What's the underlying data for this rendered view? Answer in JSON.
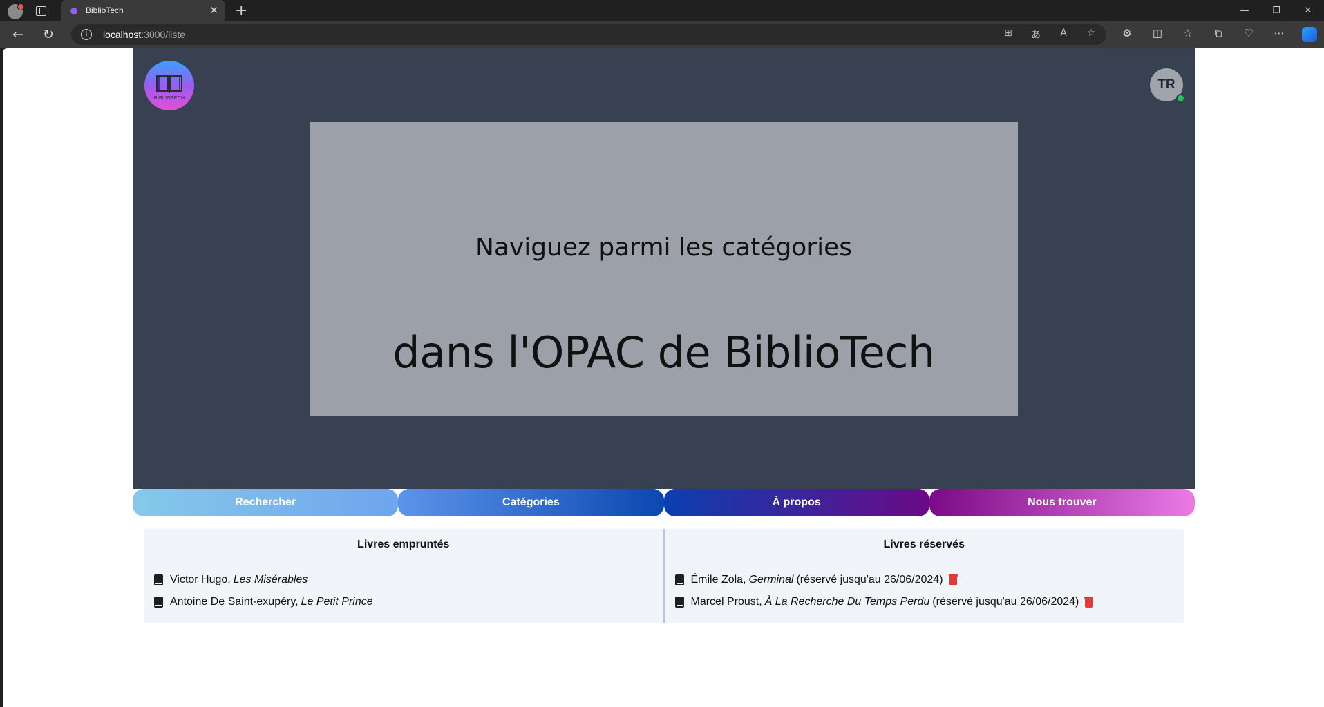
{
  "browser": {
    "tab_title": "BiblioTech",
    "url_host": "localhost",
    "url_path": ":3000/liste"
  },
  "site": {
    "logo_text": "BIBLIOTECH",
    "user_initials": "TR",
    "hero": {
      "line1": "Naviguez parmi les catégories",
      "line2": "dans l'OPAC de BiblioTech"
    },
    "nav": [
      {
        "label": "Rechercher"
      },
      {
        "label": "Catégories"
      },
      {
        "label": "À propos"
      },
      {
        "label": "Nous trouver"
      }
    ],
    "borrowed": {
      "title": "Livres empruntés",
      "items": [
        {
          "author": "Victor Hugo,",
          "book": "Les Misérables"
        },
        {
          "author": "Antoine De Saint-exupéry,",
          "book": "Le Petit Prince"
        }
      ]
    },
    "reserved": {
      "title": "Livres réservés",
      "items": [
        {
          "author": "Émile Zola,",
          "book": "Germinal",
          "note": "(réservé jusqu'au 26/06/2024)"
        },
        {
          "author": "Marcel Proust,",
          "book": "À La Recherche Du Temps Perdu",
          "note": "(réservé jusqu'au 26/06/2024)"
        }
      ]
    }
  },
  "colors": {
    "hero_bg": "#374151",
    "banner_bg": "#9ca0a8",
    "status_online": "#22c55e",
    "delete": "#e53935"
  }
}
